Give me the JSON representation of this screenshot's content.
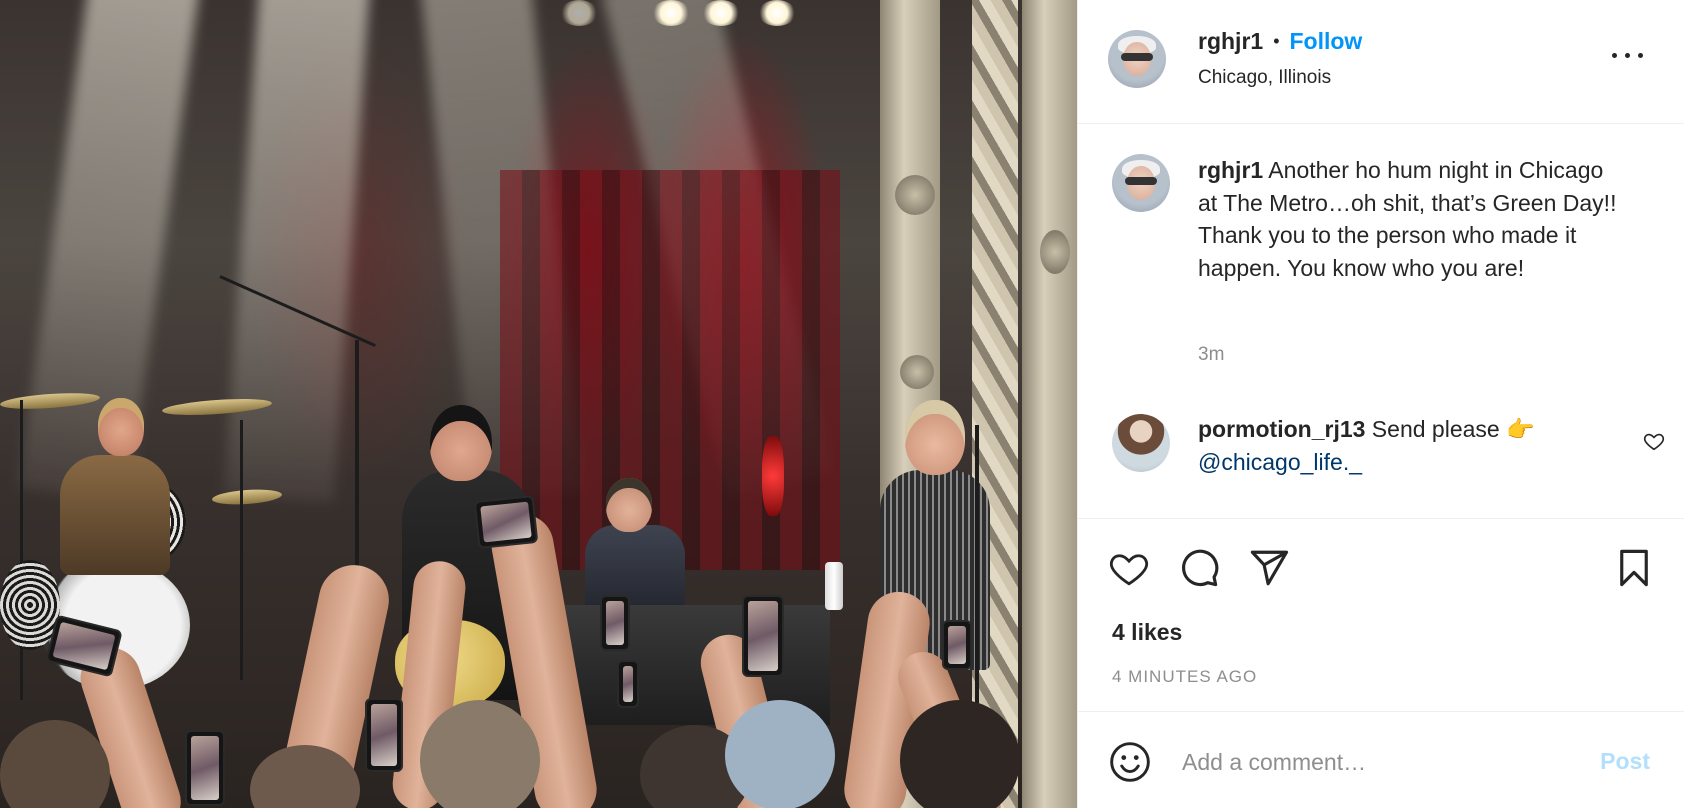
{
  "post": {
    "username": "rghjr1",
    "separator": "•",
    "follow_label": "Follow",
    "location": "Chicago, Illinois",
    "more_label": "More options"
  },
  "caption": {
    "username": "rghjr1",
    "text": " Another ho hum night in Chicago at The Metro…oh shit, that’s Green Day!! Thank you to the person who made it happen. You know who you are!",
    "time": "3m"
  },
  "comments": [
    {
      "username": "pormotion_rj13",
      "text": " Send please 👉",
      "mention": "@chicago_life._"
    }
  ],
  "engagement": {
    "likes": "4 likes",
    "posted_ago": "4 MINUTES AGO"
  },
  "comment_bar": {
    "placeholder": "Add a comment…",
    "post_label": "Post"
  },
  "icons": {
    "more": "more-horizontal-icon",
    "like": "heart-icon",
    "comment": "speech-bubble-icon",
    "share": "paper-plane-icon",
    "save": "bookmark-icon",
    "emoji": "smiley-icon"
  },
  "colors": {
    "accent": "#0095f6",
    "text": "#262626",
    "secondary": "#8e8e8e",
    "mention": "#00376b",
    "post_disabled": "#b2dffc"
  }
}
